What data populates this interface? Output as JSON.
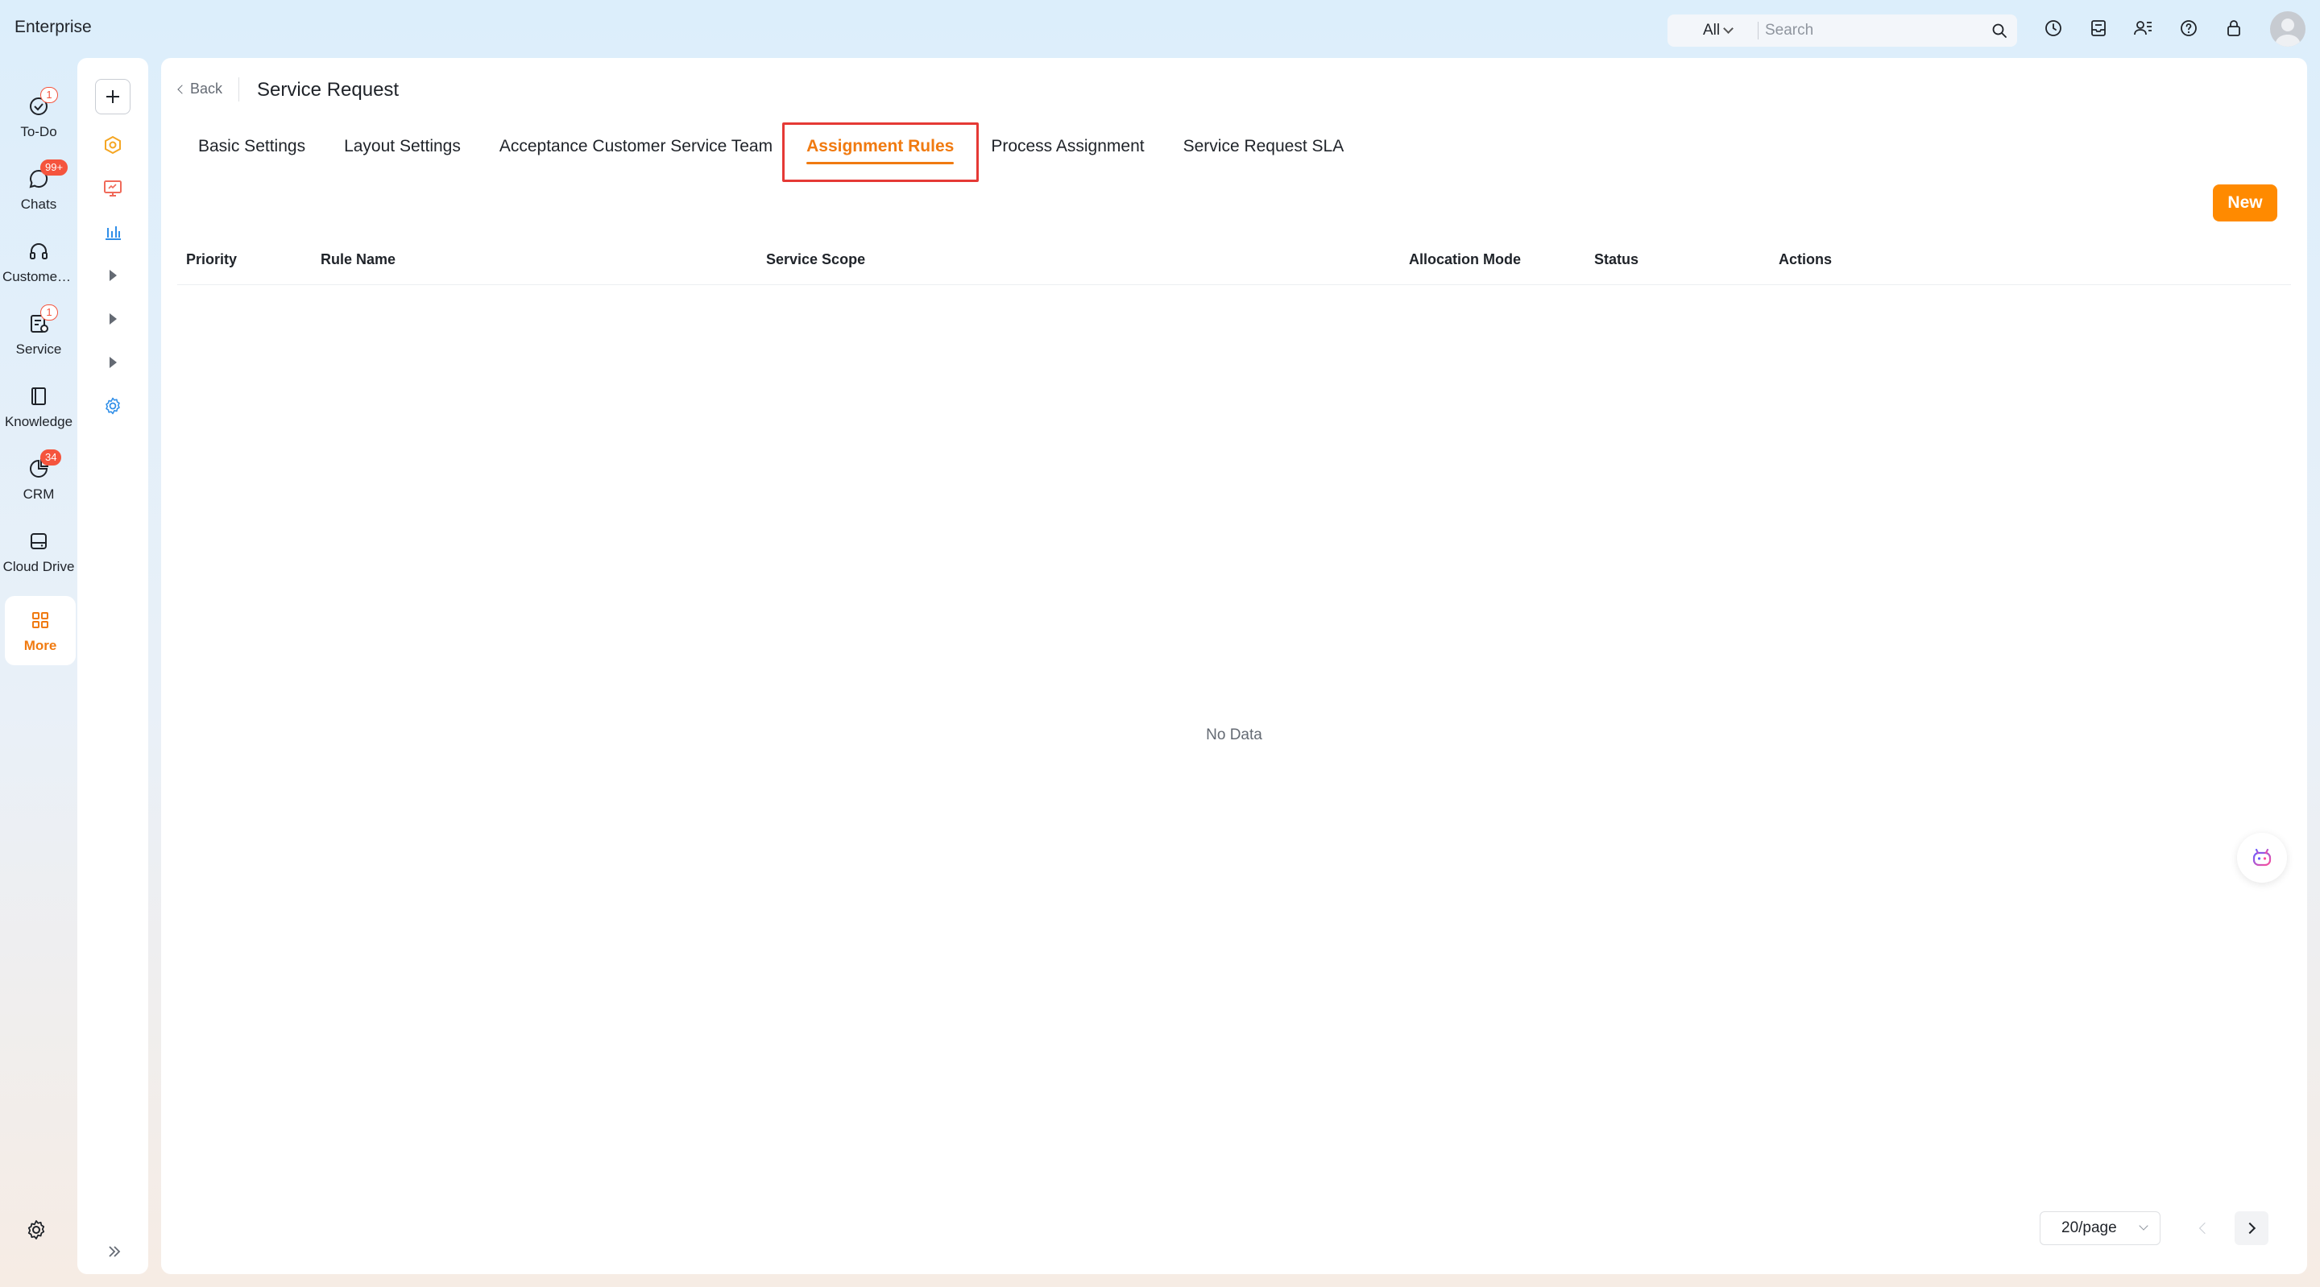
{
  "app": {
    "title": "Enterprise"
  },
  "search": {
    "scope": "All",
    "placeholder": "Search"
  },
  "rail": {
    "items": [
      {
        "label": "To-Do",
        "badge": "1"
      },
      {
        "label": "Chats",
        "badge": "99+"
      },
      {
        "label": "Customer Service",
        "badge": ""
      },
      {
        "label": "Service",
        "badge": "1"
      },
      {
        "label": "Knowledge",
        "badge": ""
      },
      {
        "label": "CRM",
        "badge": "34"
      },
      {
        "label": "Cloud Drive",
        "badge": ""
      },
      {
        "label": "More",
        "badge": ""
      }
    ]
  },
  "header": {
    "back_label": "Back",
    "page_title": "Service Request"
  },
  "tabs": [
    {
      "label": "Basic Settings"
    },
    {
      "label": "Layout Settings"
    },
    {
      "label": "Acceptance Customer Service Team"
    },
    {
      "label": "Assignment Rules"
    },
    {
      "label": "Process Assignment"
    },
    {
      "label": "Service Request SLA"
    }
  ],
  "active_tab": "Assignment Rules",
  "toolbar": {
    "new_label": "New"
  },
  "table": {
    "columns": [
      "Priority",
      "Rule Name",
      "Service Scope",
      "Allocation Mode",
      "Status",
      "Actions"
    ],
    "rows": [],
    "empty_text": "No Data"
  },
  "pagination": {
    "page_size": "20/page"
  },
  "colors": {
    "accent": "#ff8a00",
    "highlight": "#e53935",
    "badge": "#f5543d"
  },
  "icons": {
    "top": [
      "clock-icon",
      "inbox-icon",
      "contacts-icon",
      "help-icon",
      "lock-icon"
    ],
    "subnav": [
      "add-icon",
      "hexagon-icon",
      "monitor-icon",
      "bar-chart-icon",
      "expand-arrow-icon",
      "expand-arrow-icon",
      "expand-arrow-icon",
      "gear-icon"
    ]
  }
}
